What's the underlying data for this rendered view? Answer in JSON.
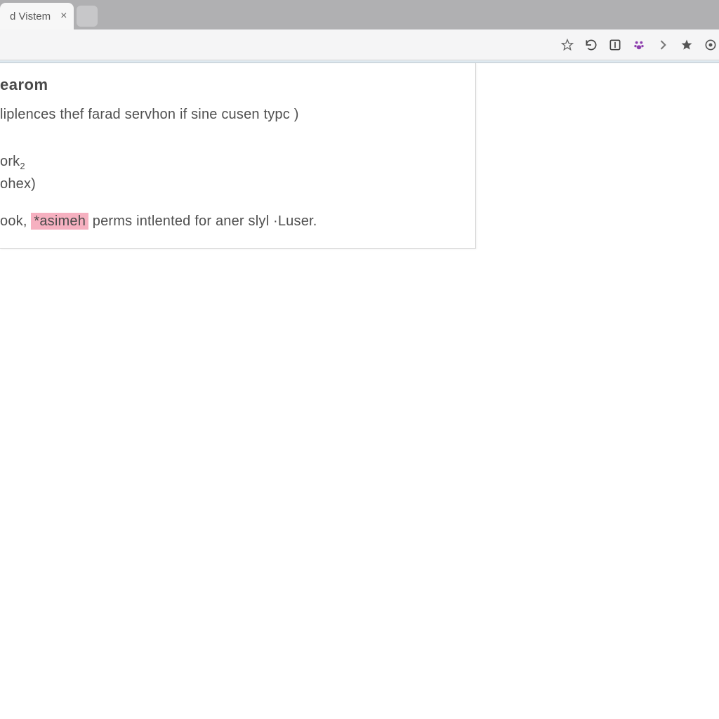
{
  "browser": {
    "tab_title": "d Vistem",
    "close_glyph": "×"
  },
  "toolbar": {
    "icons": {
      "bookmark_star": "bookmark-star-icon",
      "reload": "reload-icon",
      "boxed_one": "extension-boxed-icon",
      "paw": "extension-paw-icon",
      "chevron": "chevron-right-icon",
      "star_solid": "favorites-star-icon",
      "target": "target-icon"
    }
  },
  "content": {
    "heading": "earom",
    "line1": "liplences thef farad servhon if sine cusen typc )",
    "line2": "ork",
    "line2_sub": "2",
    "line3": "ohex)",
    "last": {
      "pre": "ook, ",
      "highlight": "*asimeh",
      "post": " perms intlented for aner slyl ·Luser."
    }
  },
  "colors": {
    "highlight_bg": "#f6b0c0",
    "tabstrip_bg": "#b0b0b2"
  }
}
